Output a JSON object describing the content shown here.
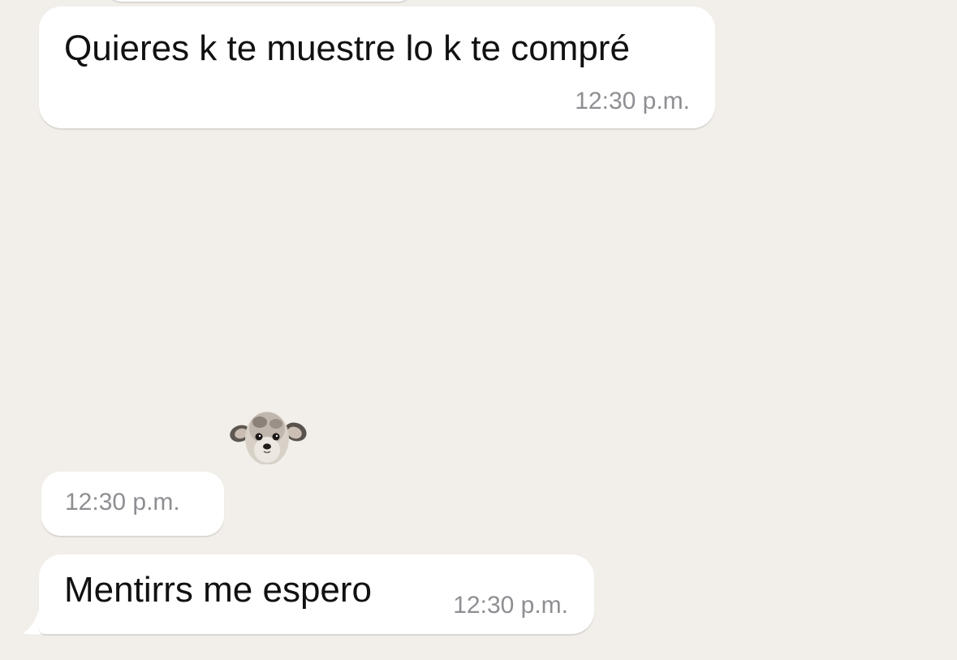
{
  "messages": [
    {
      "type": "text",
      "text": "Quieres k te muestre lo k te compré",
      "time": "12:30 p.m."
    },
    {
      "type": "sticker",
      "sticker_icon": "chihuahua-sticker-icon",
      "time": "12:30 p.m."
    },
    {
      "type": "text",
      "text": "Mentirrs me espero",
      "time": "12:30 p.m."
    }
  ],
  "colors": {
    "background": "#f2efea",
    "bubble": "#ffffff",
    "text": "#111111",
    "timestamp": "#8e8e93"
  }
}
